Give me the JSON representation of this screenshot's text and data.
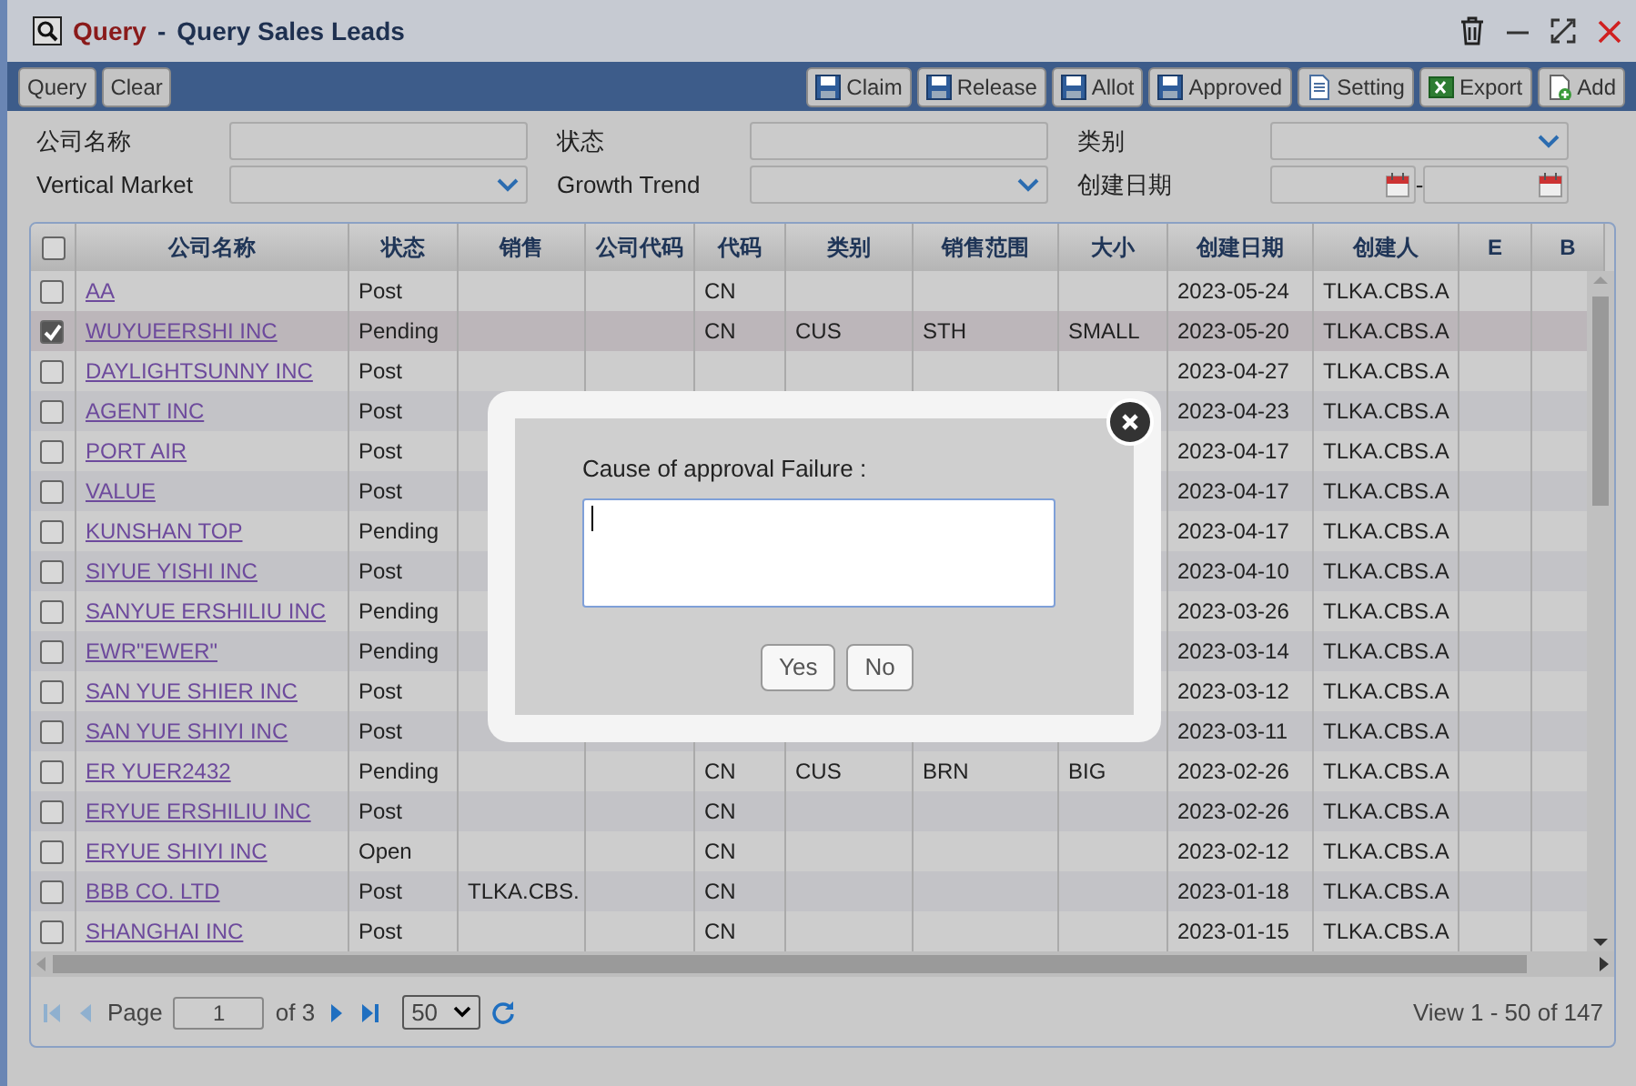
{
  "window": {
    "module": "Query",
    "separator": "-",
    "title": "Query Sales Leads"
  },
  "toolbar": {
    "left": [
      {
        "label": "Query"
      },
      {
        "label": "Clear"
      }
    ],
    "right": [
      {
        "label": "Claim",
        "kind": "save"
      },
      {
        "label": "Release",
        "kind": "save"
      },
      {
        "label": "Allot",
        "kind": "save"
      },
      {
        "label": "Approved",
        "kind": "save"
      },
      {
        "label": "Setting",
        "kind": "doc"
      },
      {
        "label": "Export",
        "kind": "excel"
      },
      {
        "label": "Add",
        "kind": "add"
      }
    ]
  },
  "filters": [
    {
      "label": "公司名称",
      "kind": "text"
    },
    {
      "label": "状态",
      "kind": "text"
    },
    {
      "label": "类别",
      "kind": "select"
    },
    {
      "label": "Vertical Market",
      "kind": "select"
    },
    {
      "label": "Growth Trend",
      "kind": "select"
    },
    {
      "label": "创建日期",
      "kind": "daterange",
      "separator": "-"
    }
  ],
  "table": {
    "select_all": {
      "checked": false
    },
    "columns": [
      "公司名称",
      "状态",
      "销售",
      "公司代码",
      "代码",
      "类别",
      "销售范围",
      "大小",
      "创建日期",
      "创建人",
      "E",
      "B"
    ],
    "rows": [
      {
        "checked": false,
        "cells": {
          "name": "AA",
          "status": "Post",
          "code": "CN",
          "date": "2023-05-24",
          "creator": "TLKA.CBS.A"
        }
      },
      {
        "checked": true,
        "cells": {
          "name": "WUYUEERSHI INC",
          "status": "Pending",
          "code": "CN",
          "category": "CUS",
          "scope": "STH",
          "size": "SMALL",
          "date": "2023-05-20",
          "creator": "TLKA.CBS.A"
        }
      },
      {
        "checked": false,
        "cells": {
          "name": "DAYLIGHTSUNNY INC",
          "status": "Post",
          "date": "2023-04-27",
          "creator": "TLKA.CBS.A"
        }
      },
      {
        "checked": false,
        "cells": {
          "name": "AGENT INC",
          "status": "Post",
          "date": "2023-04-23",
          "creator": "TLKA.CBS.A"
        }
      },
      {
        "checked": false,
        "cells": {
          "name": "PORT AIR",
          "status": "Post",
          "date": "2023-04-17",
          "creator": "TLKA.CBS.A"
        }
      },
      {
        "checked": false,
        "cells": {
          "name": "VALUE",
          "status": "Post",
          "date": "2023-04-17",
          "creator": "TLKA.CBS.A"
        }
      },
      {
        "checked": false,
        "cells": {
          "name": "KUNSHAN TOP",
          "status": "Pending",
          "date": "2023-04-17",
          "creator": "TLKA.CBS.A"
        }
      },
      {
        "checked": false,
        "cells": {
          "name": "SIYUE YISHI INC",
          "status": "Post",
          "date": "2023-04-10",
          "creator": "TLKA.CBS.A"
        }
      },
      {
        "checked": false,
        "cells": {
          "name": "SANYUE ERSHILIU INC",
          "status": "Pending",
          "date": "2023-03-26",
          "creator": "TLKA.CBS.A"
        }
      },
      {
        "checked": false,
        "cells": {
          "name": "EWR\"EWER\"",
          "status": "Pending",
          "date": "2023-03-14",
          "creator": "TLKA.CBS.A"
        }
      },
      {
        "checked": false,
        "cells": {
          "name": "SAN YUE SHIER INC",
          "status": "Post",
          "date": "2023-03-12",
          "creator": "TLKA.CBS.A"
        }
      },
      {
        "checked": false,
        "cells": {
          "name": "SAN YUE SHIYI INC",
          "status": "Post",
          "date": "2023-03-11",
          "creator": "TLKA.CBS.A"
        }
      },
      {
        "checked": false,
        "cells": {
          "name": "ER YUER2432",
          "status": "Pending",
          "code": "CN",
          "category": "CUS",
          "scope": "BRN",
          "size": "BIG",
          "date": "2023-02-26",
          "creator": "TLKA.CBS.A"
        }
      },
      {
        "checked": false,
        "cells": {
          "name": "ERYUE ERSHILIU INC",
          "status": "Post",
          "code": "CN",
          "date": "2023-02-26",
          "creator": "TLKA.CBS.A"
        }
      },
      {
        "checked": false,
        "cells": {
          "name": "ERYUE SHIYI INC",
          "status": "Open",
          "code": "CN",
          "date": "2023-02-12",
          "creator": "TLKA.CBS.A"
        }
      },
      {
        "checked": false,
        "cells": {
          "name": "BBB CO. LTD",
          "status": "Post",
          "sales": "TLKA.CBS.",
          "code": "CN",
          "date": "2023-01-18",
          "creator": "TLKA.CBS.A"
        }
      },
      {
        "checked": false,
        "cells": {
          "name": "SHANGHAI INC",
          "status": "Post",
          "code": "CN",
          "date": "2023-01-15",
          "creator": "TLKA.CBS.A"
        }
      }
    ]
  },
  "pager": {
    "nav": [
      {
        "kind": "first",
        "disabled": true
      },
      {
        "kind": "prev",
        "disabled": true
      },
      {
        "kind": "next",
        "disabled": false
      },
      {
        "kind": "last",
        "disabled": false
      }
    ],
    "page_label": "Page",
    "page": "1",
    "of": "of 3",
    "page_size": "50",
    "summary": "View 1 - 50 of 147"
  },
  "dialog": {
    "label": "Cause of approval Failure :",
    "buttons": [
      "Yes",
      "No"
    ]
  }
}
